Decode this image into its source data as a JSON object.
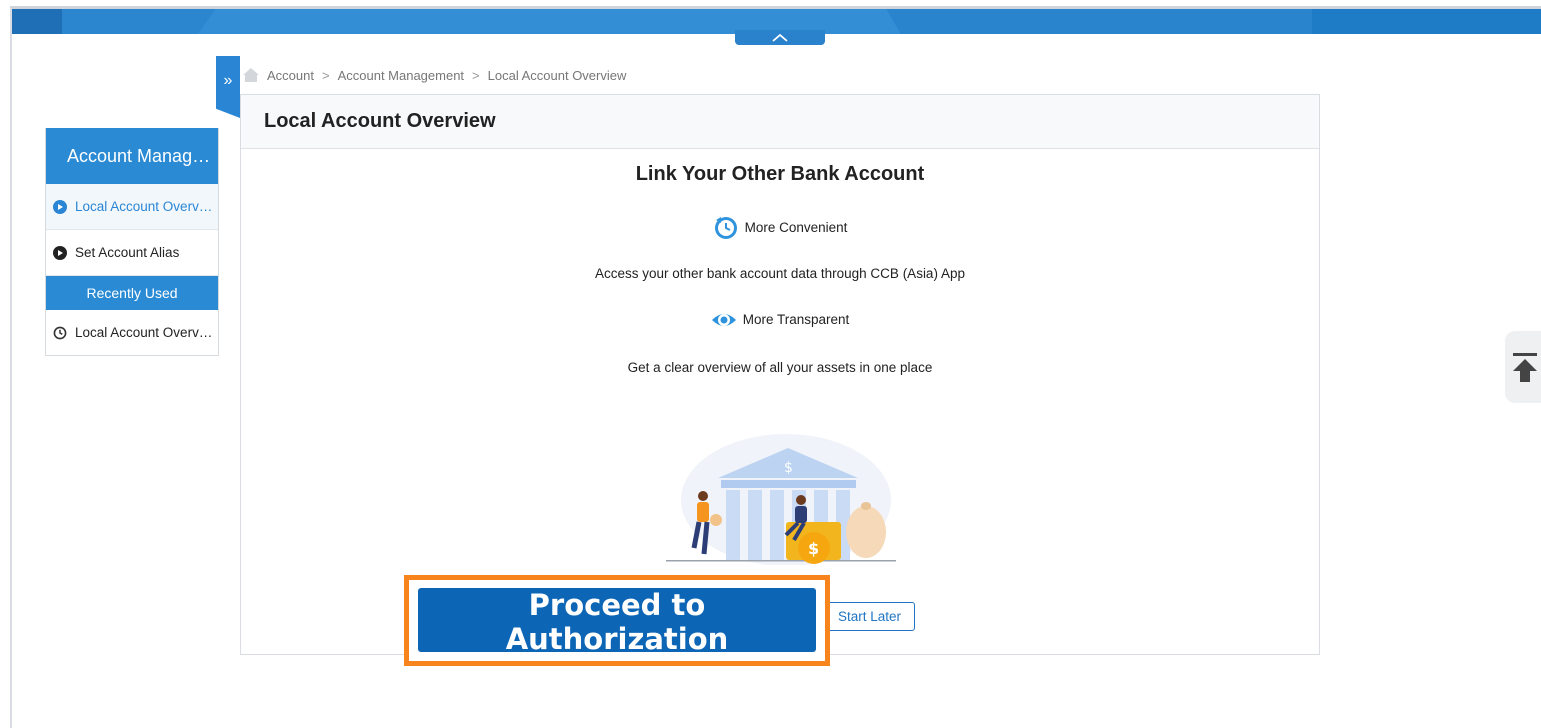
{
  "breadcrumb": {
    "items": [
      "Account",
      "Account Management",
      "Local Account Overview"
    ],
    "separator": ">"
  },
  "sidebar": {
    "title": "Account Manag…",
    "items": [
      {
        "label": "Local Account Overv…",
        "active": true
      },
      {
        "label": "Set Account Alias",
        "active": false
      }
    ],
    "recent_title": "Recently Used",
    "recent_items": [
      {
        "label": "Local Account Overv…"
      }
    ],
    "toggle_glyph": "»"
  },
  "main": {
    "header": "Local Account Overview",
    "title": "Link Your Other Bank Account",
    "features": [
      {
        "icon": "clock-icon",
        "title": "More Convenient",
        "description": "Access your other bank account data through CCB (Asia) App"
      },
      {
        "icon": "eye-icon",
        "title": "More Transparent",
        "description": "Get a clear overview of all your assets in one place"
      }
    ]
  },
  "actions": {
    "proceed_label": "Proceed to Authorization",
    "start_later_label": "Start Later"
  },
  "colors": {
    "primary": "#2a86d4",
    "button": "#0c65b5",
    "highlight": "#f7841c"
  }
}
